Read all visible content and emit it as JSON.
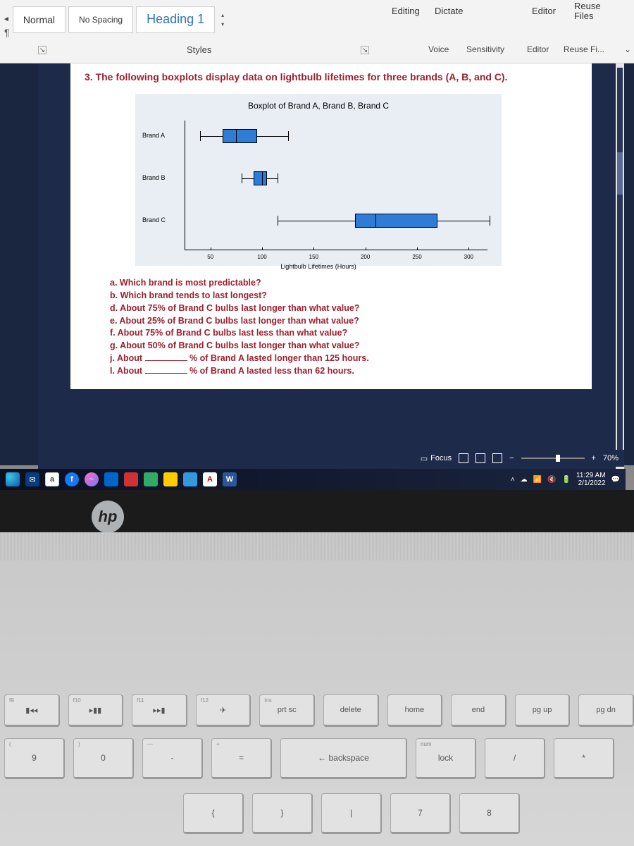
{
  "ribbon": {
    "styles": {
      "normal": "Normal",
      "no_spacing": "No Spacing",
      "heading1": "Heading 1",
      "group_label": "Styles"
    },
    "editing": "Editing",
    "dictate": "Dictate",
    "editor": "Editor",
    "reuse_files": "Reuse\nFiles",
    "voice": "Voice",
    "sensitivity": "Sensitivity",
    "editor2": "Editor",
    "reuse_fi": "Reuse Fi..."
  },
  "document": {
    "question": "3. The following boxplots display data on lightbulb lifetimes for three brands (A, B, and C).",
    "chart_title": "Boxplot of Brand A, Brand B, Brand C",
    "xlabel": "Lightbulb Lifetimes (Hours)",
    "subquestions": [
      "a. Which brand is most predictable?",
      "b. Which brand tends to last longest?",
      "d. About 75% of Brand C bulbs last longer than what value?",
      "e. About 25% of Brand C bulbs last longer than what value?",
      "f. About 75% of Brand C bulbs last less than what value?",
      "g. About 50% of Brand C bulbs last longer than what value?",
      "j. About ________ % of Brand A lasted longer than 125 hours.",
      "l. About ________ % of Brand A lasted less than 62 hours."
    ]
  },
  "chart_data": {
    "type": "boxplot",
    "title": "Boxplot of Brand A, Brand B, Brand C",
    "xlabel": "Lightbulb Lifetimes (Hours)",
    "ylabel": "",
    "xlim": [
      25,
      325
    ],
    "xticks": [
      50,
      100,
      150,
      200,
      250,
      300
    ],
    "categories": [
      "Brand A",
      "Brand B",
      "Brand C"
    ],
    "series": [
      {
        "name": "Brand A",
        "min": 40,
        "q1": 62,
        "median": 75,
        "q3": 95,
        "max": 125
      },
      {
        "name": "Brand B",
        "min": 80,
        "q1": 92,
        "median": 100,
        "q3": 105,
        "max": 115
      },
      {
        "name": "Brand C",
        "min": 115,
        "q1": 190,
        "median": 210,
        "q3": 270,
        "max": 320
      }
    ]
  },
  "status_bar": {
    "focus": "Focus",
    "zoom": "70%"
  },
  "taskbar": {
    "time": "11:29 AM",
    "date": "2/1/2022"
  },
  "keyboard": {
    "fn_row": [
      {
        "sub": "f9",
        "main": "▮◂◂"
      },
      {
        "sub": "f10",
        "main": "▸▮▮"
      },
      {
        "sub": "f11",
        "main": "▸▸▮"
      },
      {
        "sub": "f12",
        "main": "✈"
      },
      {
        "sub": "ins",
        "main": "prt sc"
      },
      {
        "sub": "",
        "main": "delete"
      },
      {
        "sub": "",
        "main": "home"
      },
      {
        "sub": "",
        "main": "end"
      },
      {
        "sub": "",
        "main": "pg up"
      },
      {
        "sub": "",
        "main": "pg dn"
      }
    ],
    "num_row": [
      {
        "top": "(",
        "main": "9"
      },
      {
        "top": ")",
        "main": "0"
      },
      {
        "top": "—",
        "main": "-"
      },
      {
        "top": "+",
        "main": "="
      },
      {
        "top": "",
        "main": "← backspace",
        "wide": true
      },
      {
        "top": "num",
        "main": "lock"
      },
      {
        "top": "",
        "main": "/"
      },
      {
        "top": "",
        "main": "*"
      }
    ],
    "third_row": [
      {
        "main": "{"
      },
      {
        "main": "}"
      },
      {
        "main": "|"
      },
      {
        "main": "7"
      },
      {
        "main": "8"
      }
    ]
  }
}
